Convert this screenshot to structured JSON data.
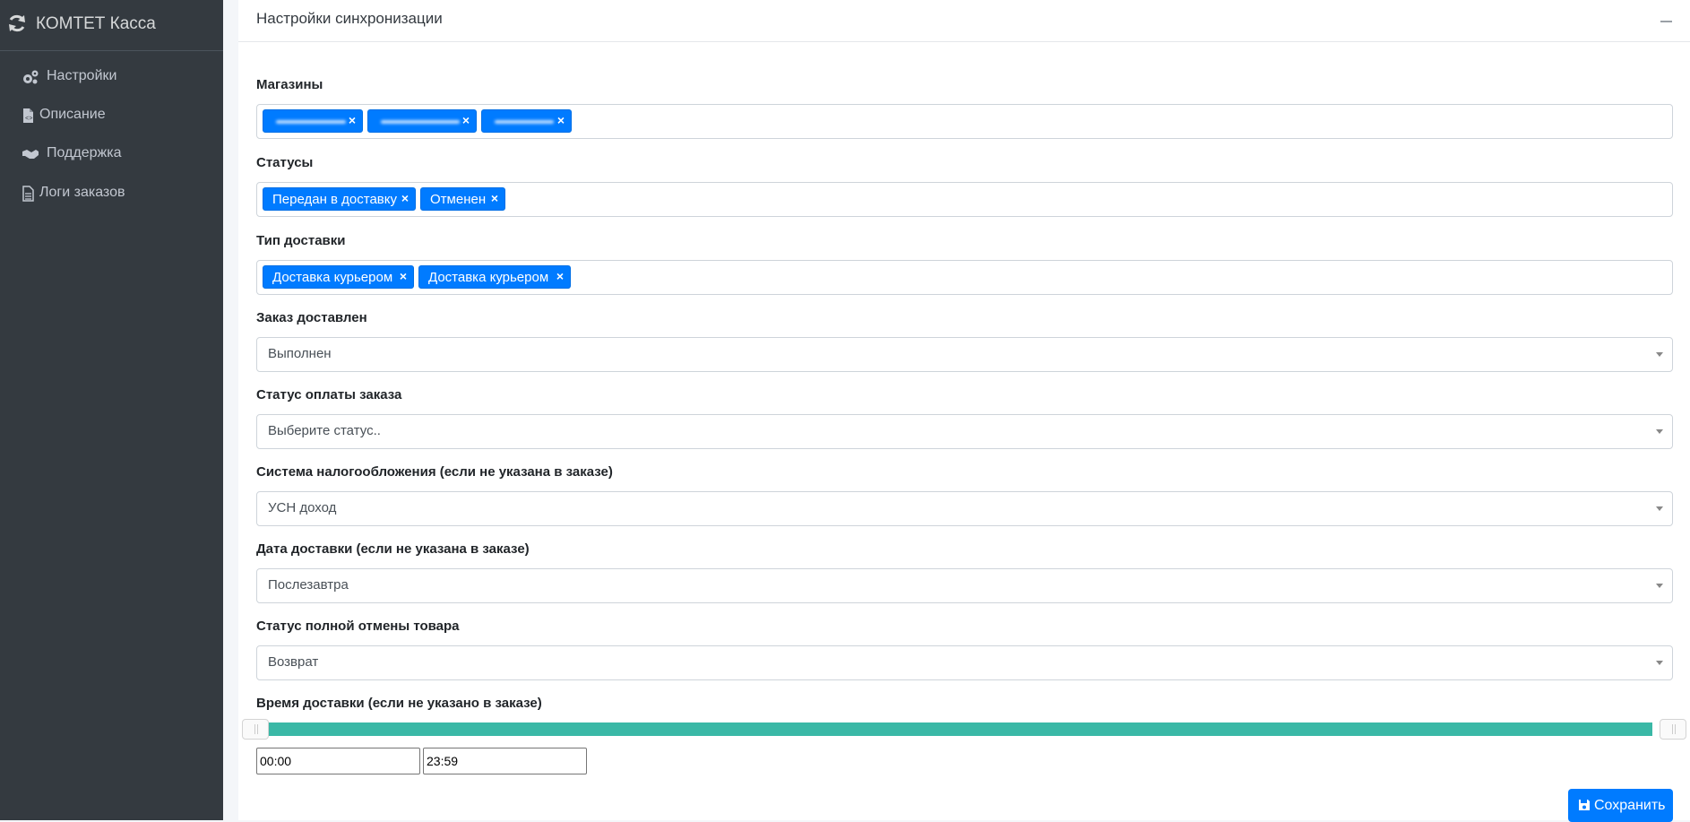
{
  "app": {
    "title": "КОМТЕТ Касса"
  },
  "sidebar": {
    "items": [
      {
        "label": "Настройки",
        "icon": "cogs-icon"
      },
      {
        "label": "Описание",
        "icon": "file-code-icon"
      },
      {
        "label": "Поддержка",
        "icon": "handshake-icon"
      },
      {
        "label": "Логи заказов",
        "icon": "file-text-icon"
      }
    ]
  },
  "card": {
    "title": "Настройки синхронизации"
  },
  "form": {
    "shops": {
      "label": "Магазины",
      "tags": [
        "",
        "",
        ""
      ]
    },
    "statuses": {
      "label": "Статусы",
      "tags": [
        "Передан в доставку",
        "Отменен"
      ]
    },
    "delivery_type": {
      "label": "Тип доставки",
      "tags": [
        "Доставка курьером",
        "Доставка курьером"
      ]
    },
    "order_delivered": {
      "label": "Заказ доставлен",
      "value": "Выполнен"
    },
    "payment_status": {
      "label": "Статус оплаты заказа",
      "value": "Выберите статус.."
    },
    "tax_system": {
      "label": "Система налогообложения (если не указана в заказе)",
      "value": "УСН доход"
    },
    "delivery_date": {
      "label": "Дата доставки (если не указана в заказе)",
      "value": "Послезавтра"
    },
    "full_cancel_status": {
      "label": "Статус полной отмены товара",
      "value": "Возврат"
    },
    "delivery_time": {
      "label": "Время доставки (если не указано в заказе)",
      "from": "00:00",
      "to": "23:59"
    }
  },
  "buttons": {
    "save": "Сохранить"
  },
  "colors": {
    "sidebar": "#343a40",
    "accent": "#007bff",
    "slider": "#3ab8a6"
  }
}
